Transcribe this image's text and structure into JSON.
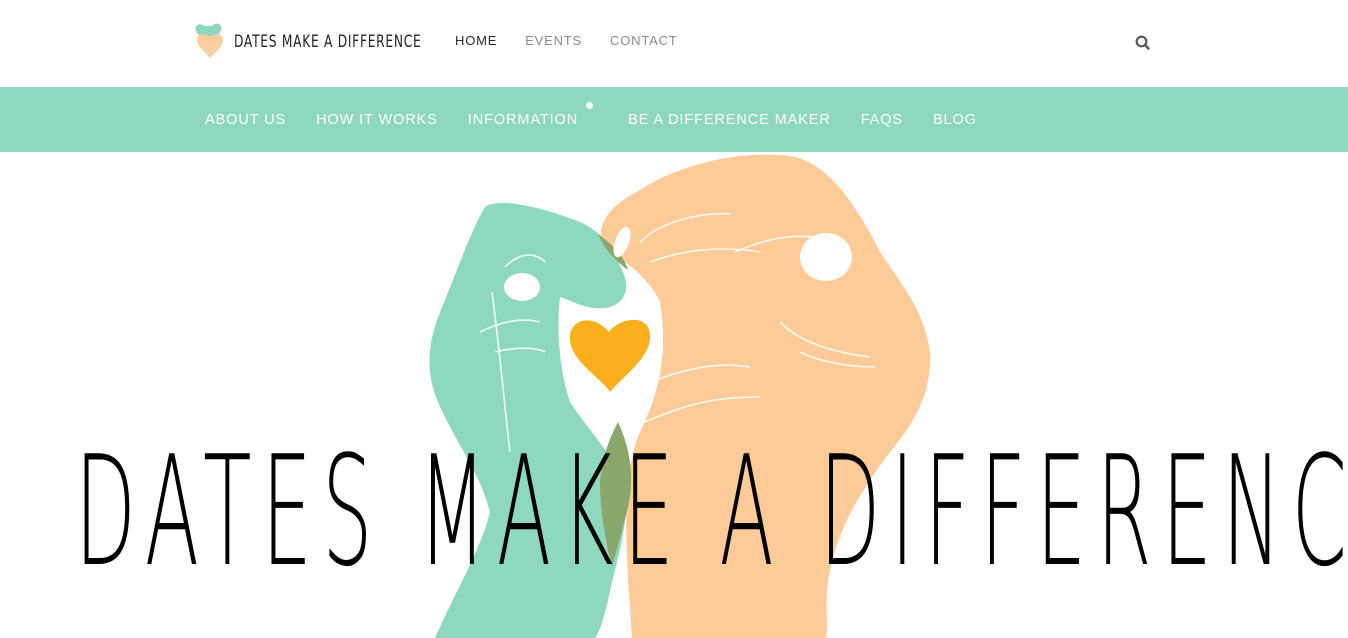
{
  "header": {
    "logo_text": "DATES MAKE A DIFFERENCE",
    "top_nav": [
      {
        "label": "HOME",
        "active": true
      },
      {
        "label": "EVENTS",
        "active": false
      },
      {
        "label": "CONTACT",
        "active": false
      }
    ],
    "search_icon": "search-icon"
  },
  "main_nav": {
    "items": [
      {
        "label": "ABOUT US"
      },
      {
        "label": "HOW IT WORKS"
      },
      {
        "label": "INFORMATION",
        "has_dot": true
      },
      {
        "label": "BE A DIFFERENCE MAKER"
      },
      {
        "label": "FAQS"
      },
      {
        "label": "BLOG"
      }
    ],
    "bar_color": "#8ed8bd"
  },
  "hero": {
    "title": "DATES MAKE A DIFFERENCE",
    "colors": {
      "left_hand": "#8ed8bd",
      "right_hand": "#fccb98",
      "heart": "#fbaf1c",
      "overlap": "#8aa76c"
    }
  }
}
